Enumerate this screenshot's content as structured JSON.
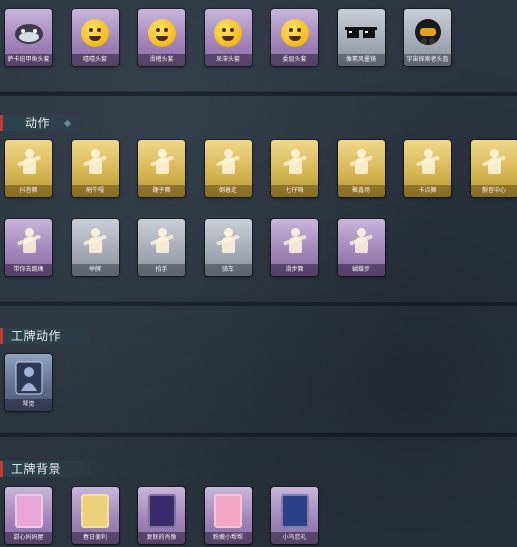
{
  "sections": {
    "action_title": "动作",
    "badge_action_title": "工牌动作",
    "badge_bg_title": "工牌背景"
  },
  "hats": [
    {
      "name": "萨卡班甲鱼头套",
      "style": "purple",
      "icon": "fish-head-icon"
    },
    {
      "name": "嘻嘻头套",
      "style": "purple",
      "icon": "grin-face-icon"
    },
    {
      "name": "滑稽头套",
      "style": "purple",
      "icon": "smirk-face-icon"
    },
    {
      "name": "呆滞头套",
      "style": "purple",
      "icon": "dazed-face-icon"
    },
    {
      "name": "委屈头套",
      "style": "purple",
      "icon": "pout-face-icon"
    },
    {
      "name": "像素风墨镜",
      "style": "grey",
      "icon": "pixel-sunglasses-icon"
    },
    {
      "name": "宇宙探索者头盔",
      "style": "grey",
      "icon": "space-helmet-icon"
    }
  ],
  "actions_row1": [
    {
      "name": "抖音舞",
      "style": "gold",
      "icon": "dance-figure-icon"
    },
    {
      "name": "刷牛嘎",
      "style": "gold",
      "icon": "dance-figure-icon"
    },
    {
      "name": "鞭子舞",
      "style": "gold",
      "icon": "dance-figure-icon"
    },
    {
      "name": "倒着走",
      "style": "gold",
      "icon": "dance-figure-icon"
    },
    {
      "name": "七仔嗨",
      "style": "gold",
      "icon": "dance-figure-icon"
    },
    {
      "name": "聚鑫场",
      "style": "gold",
      "icon": "dance-figure-icon"
    },
    {
      "name": "卡点舞",
      "style": "gold",
      "icon": "dance-figure-icon"
    },
    {
      "name": "颤音中心",
      "style": "gold",
      "icon": "dance-figure-icon"
    }
  ],
  "actions_row2": [
    {
      "name": "带你去跳绳",
      "style": "purple",
      "icon": "jump-rope-figure-icon"
    },
    {
      "name": "举牌",
      "style": "grey",
      "icon": "sign-figure-icon"
    },
    {
      "name": "拍手",
      "style": "grey",
      "icon": "clap-figure-icon"
    },
    {
      "name": "骑车",
      "style": "grey",
      "icon": "bike-figure-icon"
    },
    {
      "name": "滑步舞",
      "style": "purple",
      "icon": "slide-figure-icon"
    },
    {
      "name": "蝴蝶步",
      "style": "purple",
      "icon": "butterfly-figure-icon"
    }
  ],
  "badge_actions": [
    {
      "name": "琴觉",
      "style": "steel",
      "icon": "silhouette-icon"
    }
  ],
  "badge_backgrounds": [
    {
      "name": "甜心妈妈屋",
      "style": "purple",
      "icon": "pink-room-icon",
      "color": "#e8a6d8"
    },
    {
      "name": "春日便利",
      "style": "purple",
      "icon": "yellow-card-icon",
      "color": "#e9d27a"
    },
    {
      "name": "复联的肖像",
      "style": "purple",
      "icon": "night-portrait-icon",
      "color": "#3a2c6a"
    },
    {
      "name": "粉嫩小帮帮",
      "style": "purple",
      "icon": "pink-box-icon",
      "color": "#f2a6c4"
    },
    {
      "name": "小鸟恋礼",
      "style": "purple",
      "icon": "starry-card-icon",
      "color": "#2d3f86"
    }
  ]
}
